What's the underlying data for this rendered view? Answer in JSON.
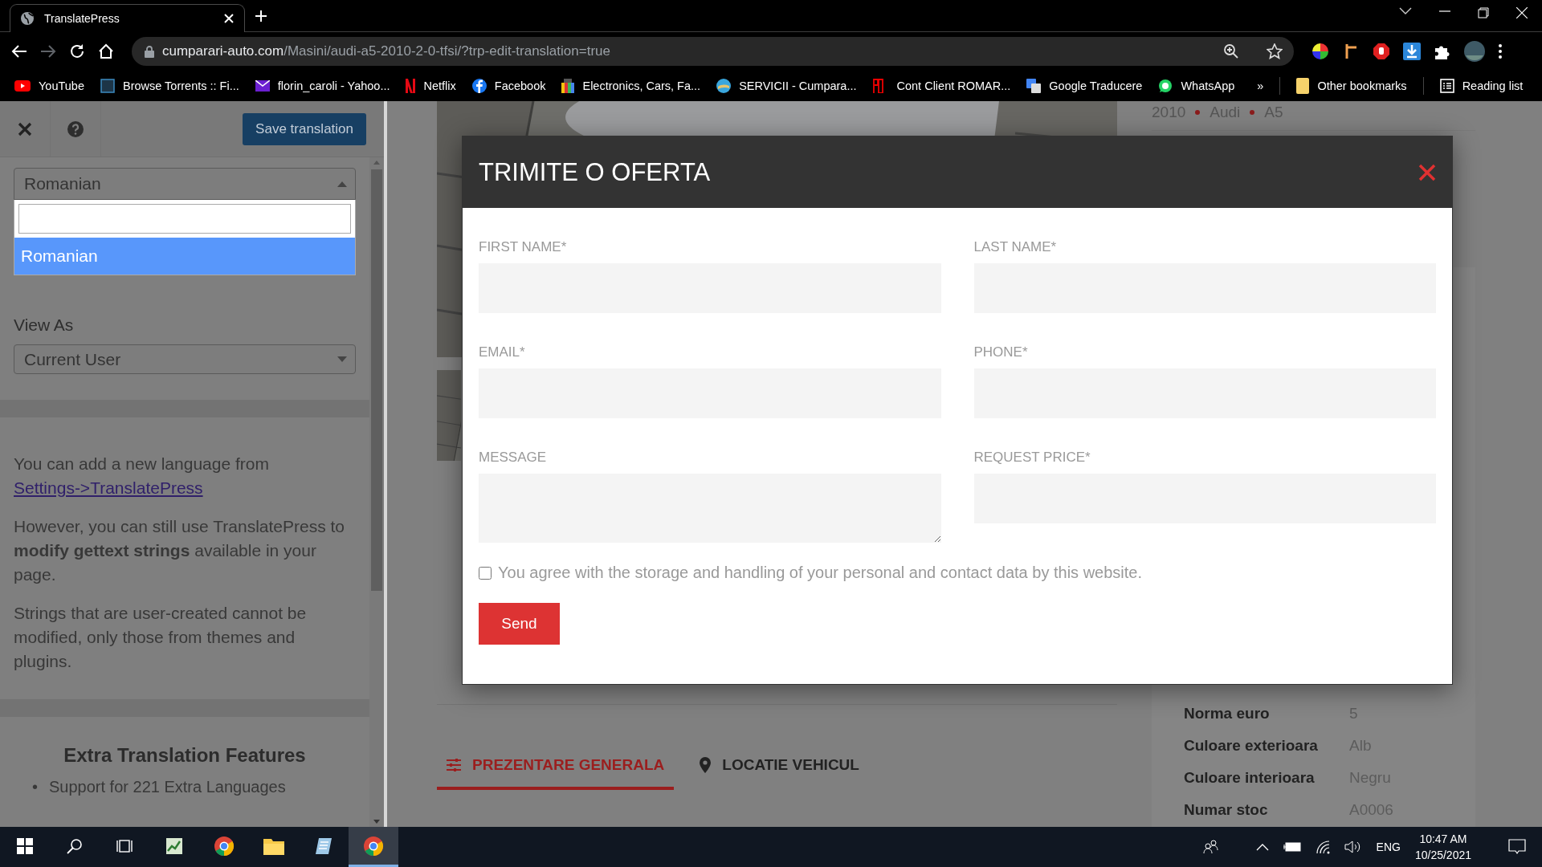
{
  "browser": {
    "tab": {
      "title": "TranslatePress"
    },
    "nav": {
      "forward_disabled": true
    },
    "url": {
      "domain": "cumparari-auto.com",
      "path": "/Masini/audi-a5-2010-2-0-tfsi/?trp-edit-translation=true"
    },
    "bookmarks": [
      {
        "kind": "youtube",
        "label": "YouTube"
      },
      {
        "kind": "fl",
        "label": "Browse Torrents :: Fi..."
      },
      {
        "kind": "mail",
        "label": "florin_caroli - Yahoo..."
      },
      {
        "kind": "netflix",
        "label": "Netflix"
      },
      {
        "kind": "facebook",
        "label": "Facebook"
      },
      {
        "kind": "gift",
        "label": "Electronics, Cars, Fa..."
      },
      {
        "kind": "globe",
        "label": "SERVICII - Cumpara..."
      },
      {
        "kind": "ro",
        "label": "Cont Client ROMAR..."
      },
      {
        "kind": "translate",
        "label": "Google Traducere"
      },
      {
        "kind": "whatsapp",
        "label": "WhatsApp"
      }
    ],
    "overflow": "»",
    "other_bookmarks": "Other bookmarks",
    "reading_list": "Reading list"
  },
  "translate_panel": {
    "save_button": "Save translation",
    "language_select": {
      "value": "Romanian",
      "expanded": true,
      "options": [
        {
          "label": "Romanian",
          "selected": true
        }
      ]
    },
    "view_as": {
      "label": "View As",
      "value": "Current User"
    },
    "paragraphs": [
      {
        "text": "You can add a new language from ",
        "link": "Settings->TranslatePress"
      },
      {
        "text": "However, you can still use TranslatePress to **modify gettext strings** available in your page."
      },
      {
        "text": "Strings that are user-created cannot be modified, only those from themes and plugins."
      }
    ],
    "extra": {
      "title": "Extra Translation Features",
      "items": [
        {
          "marker": "•",
          "text": "Support for 221 Extra Languages"
        }
      ]
    }
  },
  "page": {
    "breadcrumb": [
      "2010",
      "Audi",
      "A5"
    ],
    "tabs": [
      {
        "label": "PREZENTARE GENERALA",
        "kind": "overview",
        "selected": true
      },
      {
        "label": "LOCATIE VEHICUL",
        "kind": "location",
        "selected": false
      }
    ],
    "specs": [
      {
        "label": "Norma euro",
        "value": "5"
      },
      {
        "label": "Culoare exterioara",
        "value": "Alb"
      },
      {
        "label": "Culoare interioara",
        "value": "Negru"
      },
      {
        "label": "Numar stoc",
        "value": "A0006"
      }
    ]
  },
  "modal": {
    "title": "TRIMITE O OFERTA",
    "fields": [
      {
        "label": "FIRST NAME*",
        "kind": "input"
      },
      {
        "label": "LAST NAME*",
        "kind": "input"
      },
      {
        "label": "EMAIL*",
        "kind": "input"
      },
      {
        "label": "PHONE*",
        "kind": "input"
      },
      {
        "label": "MESSAGE",
        "kind": "textarea"
      },
      {
        "label": "REQUEST PRICE*",
        "kind": "input"
      }
    ],
    "consent": {
      "text": "You agree with the storage and handling of your personal and contact data by this website.",
      "checked": false
    },
    "submit": "Send"
  },
  "taskbar": {
    "apps": [
      {
        "kind": "sheet",
        "active": false
      },
      {
        "kind": "chrome",
        "active": false
      },
      {
        "kind": "folder",
        "active": false
      },
      {
        "kind": "notes",
        "active": false
      },
      {
        "kind": "chrome",
        "active": true
      }
    ],
    "language": "ENG",
    "time": "10:47 AM",
    "date": "10/25/2021"
  }
}
